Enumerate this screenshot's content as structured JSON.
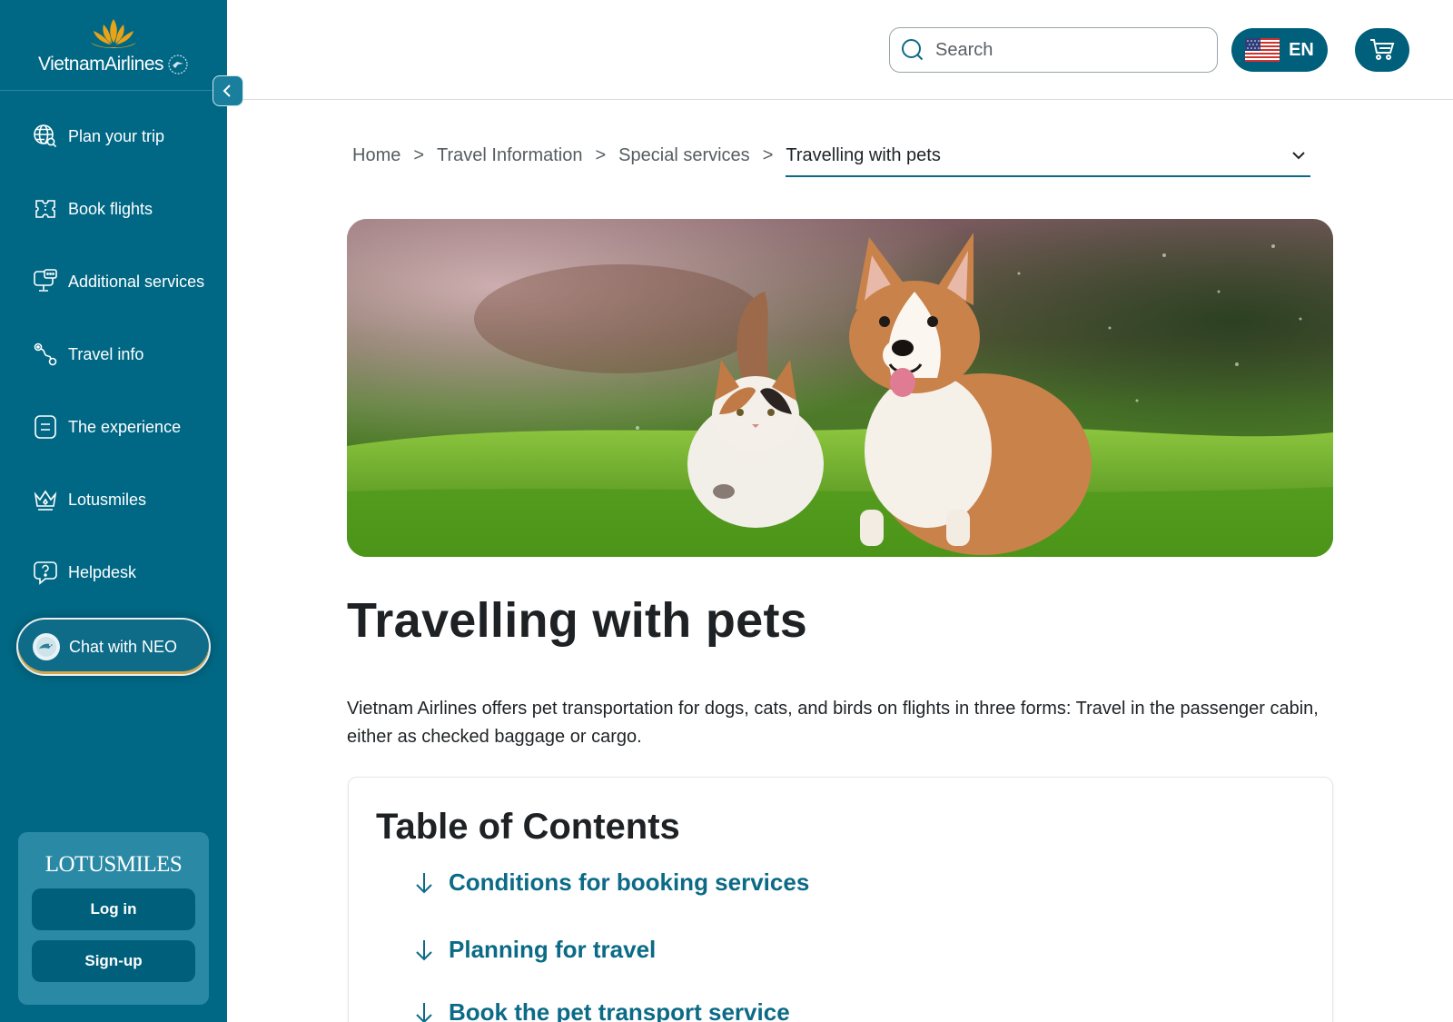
{
  "brand": {
    "name": "VietnamAirlines",
    "accent": "#006885",
    "accent_dark": "#005f7b",
    "lotus_color": "#e8a317"
  },
  "sidebar": {
    "items": [
      {
        "label": "Plan your trip",
        "icon": "globe-search-icon"
      },
      {
        "label": "Book flights",
        "icon": "ticket-icon"
      },
      {
        "label": "Additional services",
        "icon": "chat-monitor-icon"
      },
      {
        "label": "Travel info",
        "icon": "route-icon"
      },
      {
        "label": "The experience",
        "icon": "menu-box-icon"
      },
      {
        "label": "Lotusmiles",
        "icon": "crown-icon"
      },
      {
        "label": "Helpdesk",
        "icon": "help-bubble-icon"
      }
    ],
    "chat_label": "Chat with NEO",
    "loyalty": {
      "title": "LOTUSMILES",
      "login_label": "Log in",
      "signup_label": "Sign-up"
    }
  },
  "header": {
    "search_placeholder": "Search",
    "language": "EN"
  },
  "breadcrumb": {
    "items": [
      "Home",
      "Travel Information",
      "Special services"
    ],
    "separator": ">",
    "current": "Travelling with pets"
  },
  "content": {
    "title": "Travelling with pets",
    "intro": "Vietnam Airlines offers pet transportation for dogs, cats, and birds on flights in three forms: Travel in the passenger cabin, either as checked baggage or cargo.",
    "toc_title": "Table of Contents",
    "toc_items": [
      "Conditions for booking services",
      "Planning for travel",
      "Book the pet transport service"
    ]
  }
}
